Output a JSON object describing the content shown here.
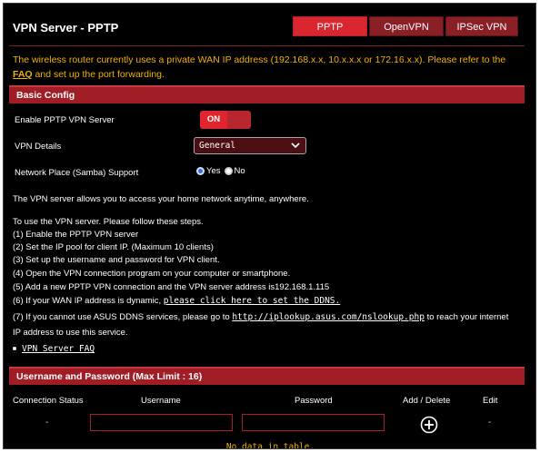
{
  "header": {
    "title": "VPN Server - PPTP",
    "tabs": [
      {
        "label": "PPTP",
        "active": true
      },
      {
        "label": "OpenVPN",
        "active": false
      },
      {
        "label": "IPSec VPN",
        "active": false
      }
    ]
  },
  "notice": {
    "text": "The wireless router currently uses a private WAN IP address (192.168.x.x, 10.x.x.x or 172.16.x.x). Please refer to the ",
    "link": "FAQ",
    "suffix": " and set up the port forwarding."
  },
  "basic_config": {
    "heading": "Basic Config",
    "enable_label": "Enable PPTP VPN Server",
    "enable_value": "ON",
    "details_label": "VPN Details",
    "details_value": "General",
    "samba_label": "Network Place (Samba) Support",
    "samba_yes": "Yes",
    "samba_no": "No"
  },
  "instructions": {
    "intro": "The VPN server allows you to access your home network anytime, anywhere.",
    "steps_title": "To use the VPN server. Please follow these steps.",
    "step1": "(1) Enable the PPTP VPN server",
    "step2": "(2) Set the IP pool for client IP. (Maximum 10 clients)",
    "step3": "(3) Set up the username and password for VPN client.",
    "step4": "(4) Open the VPN connection program on your computer or smartphone.",
    "step5": "(5) Add a new PPTP VPN connection and the VPN server address is192.168.1.115",
    "step6_text": "(6) If your WAN IP address is dynamic, ",
    "step6_link": "please click here to set the DDNS.",
    "step7_text": "(7) If you cannot use ASUS DDNS services, please go to ",
    "step7_link": "http://iplookup.asus.com/nslookup.php",
    "step7_suffix": " to reach your internet",
    "step7_cont": "IP address to use this service.",
    "faq_link": "VPN Server FAQ"
  },
  "users": {
    "heading": "Username and Password (Max Limit : 16)",
    "columns": [
      "Connection Status",
      "Username",
      "Password",
      "Add / Delete",
      "Edit"
    ],
    "row_status": "-",
    "row_edit": "-",
    "empty_text": "No data in table."
  },
  "colors": {
    "accent": "#d9262f",
    "section": "#a11d25",
    "warning": "#f0b400"
  }
}
